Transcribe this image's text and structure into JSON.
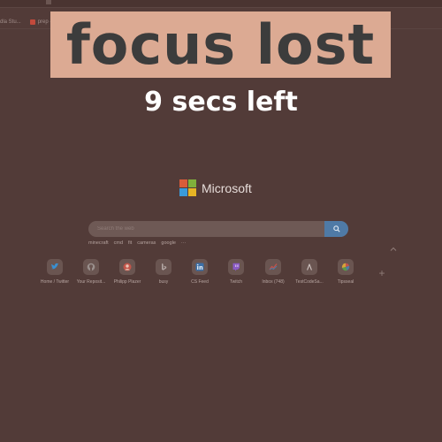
{
  "overlay": {
    "banner": "focus lost",
    "countdown": "9 secs left"
  },
  "bookmarks": [
    {
      "label": "dla Stu..."
    },
    {
      "label": "prep - npm"
    }
  ],
  "brand": {
    "name": "Microsoft",
    "logo_colors": [
      "#d95c39",
      "#7fb03b",
      "#3a9bd9",
      "#e6b425"
    ]
  },
  "search": {
    "placeholder": "Search the web",
    "suggestions": [
      "minecraft",
      "cmd",
      "fit",
      "cameras",
      "google"
    ]
  },
  "tiles": [
    {
      "label": "Home / Twitter",
      "icon": "twitter-icon",
      "color": "#3a8fd0"
    },
    {
      "label": "Your Reposit...",
      "icon": "github-icon",
      "color": "#9a8f8c"
    },
    {
      "label": "Philipp Plazer",
      "icon": "avatar-icon",
      "color": "#c2554a"
    },
    {
      "label": "busy",
      "icon": "bing-icon",
      "color": "#9a8f8c"
    },
    {
      "label": "CS Feed",
      "icon": "linkedin-icon",
      "color": "#3b6fa8"
    },
    {
      "label": "Twitch",
      "icon": "twitch-icon",
      "color": "#8a5bc4"
    },
    {
      "label": "Inbox (748)",
      "icon": "chart-icon",
      "color": "#c4524a"
    },
    {
      "label": "TestCodeSa...",
      "icon": "code-icon",
      "color": "#cfc3c0"
    },
    {
      "label": "Tipsseal",
      "icon": "google-icon",
      "color": "#d6a23a"
    }
  ]
}
